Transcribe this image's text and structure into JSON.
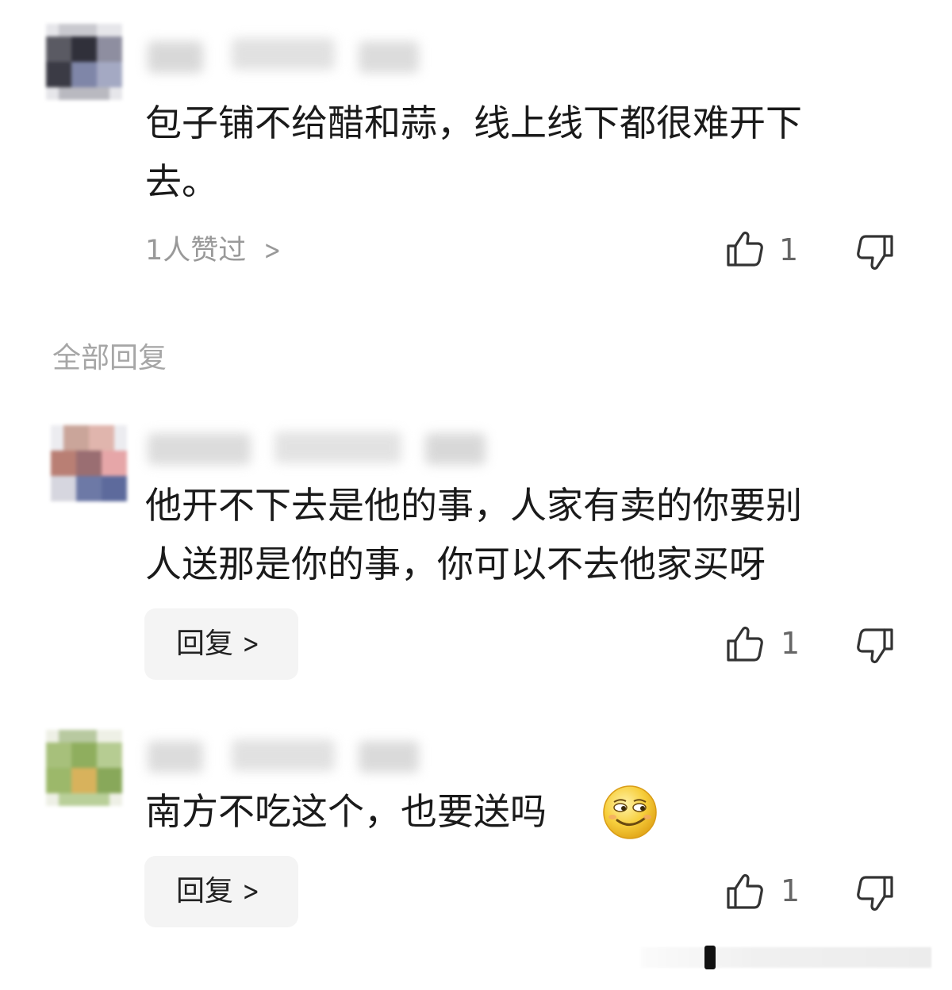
{
  "comment": {
    "text_line1": "包子铺不给醋和蒜，线上线下都很难开下",
    "text_line2": "去。",
    "likes_link": "1人赞过",
    "like_count": "1"
  },
  "section": {
    "title": "全部回复"
  },
  "replies": [
    {
      "text_line1": "他开不下去是他的事，人家有卖的你要别",
      "text_line2": "人送那是你的事，你可以不去他家买呀",
      "reply_label": "回复",
      "like_count": "1"
    },
    {
      "text_line1": "南方不吃这个，也要送吗",
      "reply_label": "回复",
      "like_count": "1",
      "emoji": "smirk-emoji"
    }
  ],
  "icons": {
    "like": "thumbs-up-icon",
    "dislike": "thumbs-down-icon",
    "chevron": "chevron-right-icon"
  },
  "colors": {
    "text": "#1a1a1a",
    "muted": "#999999",
    "button_bg": "#f4f4f4",
    "emoji_yellow": "#f7cf3d"
  }
}
